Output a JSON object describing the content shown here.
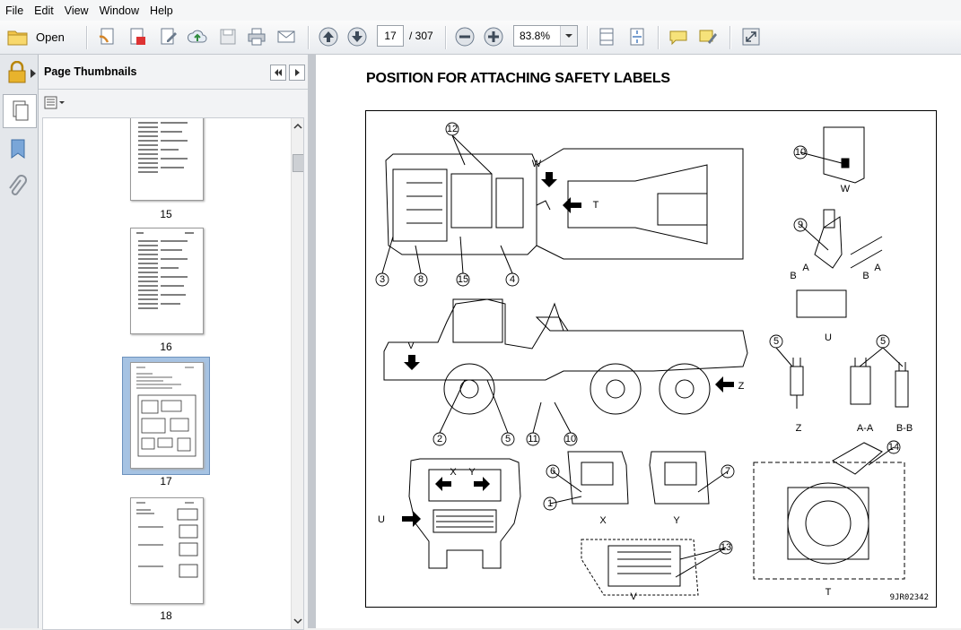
{
  "menu": [
    "File",
    "Edit",
    "View",
    "Window",
    "Help"
  ],
  "toolbar": {
    "open_label": "Open",
    "page_current": "17",
    "page_total": "/ 307",
    "zoom": "83.8%"
  },
  "panel": {
    "title": "Page Thumbnails",
    "thumbnails": [
      {
        "label": "15"
      },
      {
        "label": "16"
      },
      {
        "label": "17",
        "selected": true
      },
      {
        "label": "18"
      }
    ]
  },
  "document": {
    "title": "POSITION FOR ATTACHING SAFETY LABELS",
    "figure_code": "9JR02342",
    "view_labels": [
      "W",
      "U",
      "Z",
      "A-A",
      "B-B",
      "X",
      "Y",
      "V",
      "T"
    ],
    "callouts": [
      "1",
      "2",
      "3",
      "4",
      "5",
      "6",
      "7",
      "8",
      "9",
      "10",
      "11",
      "12",
      "13",
      "14",
      "15"
    ],
    "section_markers": [
      "A",
      "B",
      "V",
      "W",
      "T",
      "U",
      "X",
      "Y",
      "Z"
    ]
  }
}
